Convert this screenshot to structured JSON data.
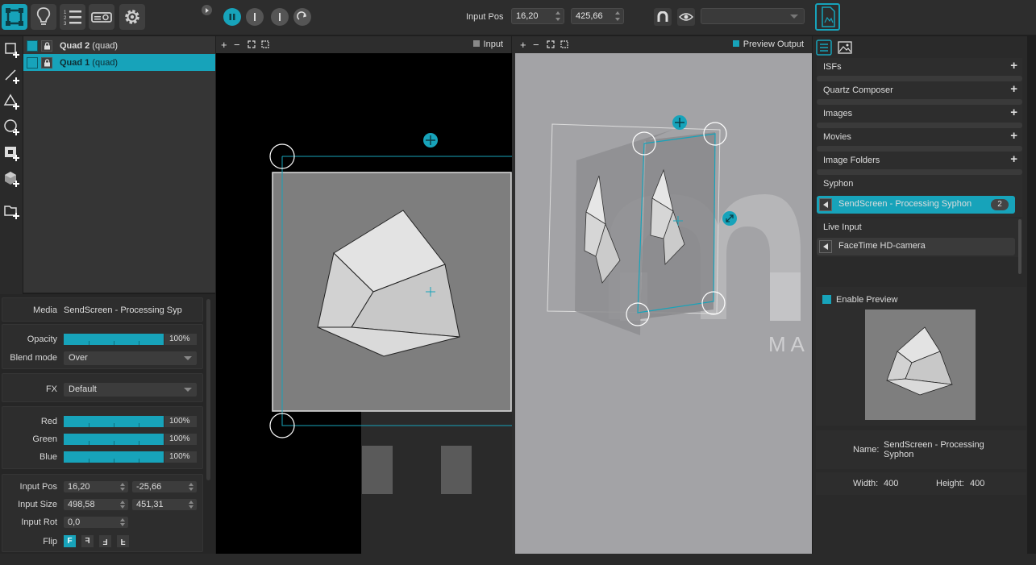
{
  "toolbar": {
    "input_pos_label": "Input Pos",
    "input_pos_x": "16,20",
    "input_pos_y": "425,66",
    "dropdown_value": ""
  },
  "layers": [
    {
      "name": "Quad 2",
      "type": "(quad)",
      "selected": false
    },
    {
      "name": "Quad 1",
      "type": "(quad)",
      "selected": true
    }
  ],
  "properties": {
    "media_label": "Media",
    "media_value": "SendScreen - Processing Syp",
    "opacity_label": "Opacity",
    "opacity_value": "100%",
    "blend_label": "Blend mode",
    "blend_value": "Over",
    "fx_label": "FX",
    "fx_value": "Default",
    "red_label": "Red",
    "red_value": "100%",
    "green_label": "Green",
    "green_value": "100%",
    "blue_label": "Blue",
    "blue_value": "100%",
    "input_pos_label": "Input Pos",
    "input_pos_x": "16,20",
    "input_pos_y": "-25,66",
    "input_size_label": "Input Size",
    "input_size_w": "498,58",
    "input_size_h": "451,31",
    "input_rot_label": "Input Rot",
    "input_rot_value": "0,0",
    "flip_label": "Flip",
    "flip_options": [
      "F",
      "F",
      "F",
      "F"
    ]
  },
  "input_canvas": {
    "title": "Input"
  },
  "output_canvas": {
    "title": "Preview Output",
    "watermark_text": "M A"
  },
  "library": {
    "categories": [
      "ISFs",
      "Quartz Composer",
      "Images",
      "Movies",
      "Image Folders"
    ],
    "syphon_label": "Syphon",
    "syphon_source": "SendScreen - Processing Syphon",
    "syphon_count": "2",
    "live_input_label": "Live Input",
    "live_source": "FaceTime HD-camera"
  },
  "preview": {
    "enable_label": "Enable Preview",
    "name_label": "Name:",
    "name_value_line1": "SendScreen - Processing",
    "name_value_line2": "Syphon",
    "width_label": "Width:",
    "width_value": "400",
    "height_label": "Height:",
    "height_value": "400"
  },
  "colors": {
    "accent": "#17a3ba",
    "panel": "#2d2d2d",
    "canvas_grey": "#a3a3a6"
  }
}
